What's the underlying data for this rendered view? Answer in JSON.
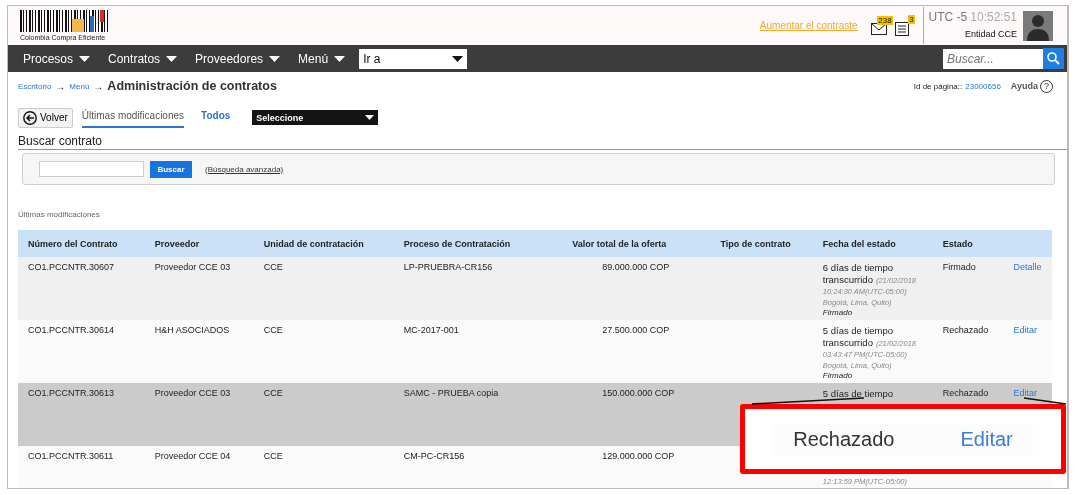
{
  "header": {
    "logo_text": "Colombia Compra Eficiente",
    "contrast_link": "Aumentar el contraste",
    "messages_count": "238",
    "notifications_count": "3",
    "timezone": "UTC -5",
    "time": "10:52:51",
    "user": "Entidad CCE"
  },
  "nav": {
    "items": [
      "Procesos",
      "Contratos",
      "Proveedores",
      "Menú"
    ],
    "goto": "Ir a",
    "search_placeholder": "Buscar..."
  },
  "breadcrumb": {
    "links": [
      "Escritorio",
      "Menú"
    ],
    "separator": "→",
    "help_mark": "?",
    "title": "Administración de contratos",
    "page_id_label": "Id de página::",
    "page_id": "23000656",
    "help": "Ayuda"
  },
  "toolbar": {
    "back": "Volver",
    "tabs": [
      {
        "label": "Últimas modificaciones",
        "selected": true
      },
      {
        "label": "Todos",
        "selected": false
      }
    ],
    "select": "Seleccione"
  },
  "search": {
    "title": "Buscar contrato",
    "button": "Buscar",
    "advanced": "(Búsqueda avanzada)"
  },
  "list_label": "Últimas modificaciones",
  "table": {
    "columns": [
      "Número del Contrato",
      "Proveedor",
      "Unidad de contratación",
      "Proceso de Contratación",
      "Valor total de la oferta",
      "Tipo de contrato",
      "Fecha del estado",
      "Estado"
    ],
    "rows": [
      {
        "number": "CO1.PCCNTR.30607",
        "provider": "Proveedor CCE 03",
        "unit": "CCE",
        "process": "LP-PRUEBRA-CR156",
        "value": "89.000.000 COP",
        "date": {
          "elapsed": "6 días de tiempo transcurrido",
          "stamp": "(21/02/2018 10:24:30 AM(UTC-05:00) Bogotá, Lima, Quito)",
          "state": "Firmado"
        },
        "status": "Firmado",
        "action": "Detalle",
        "selected": false
      },
      {
        "number": "CO1.PCCNTR.30614",
        "provider": "H&H ASOCIADOS",
        "unit": "CCE",
        "process": "MC-2017-001",
        "value": "27.500.000 COP",
        "date": {
          "elapsed": "5 días de tiempo transcurrido",
          "stamp": "(21/02/2018 03:43:47 PM(UTC-05:00) Bogotá, Lima, Quito)",
          "state": "Firmado"
        },
        "status": "Rechazado",
        "action": "Editar",
        "selected": false
      },
      {
        "number": "CO1.PCCNTR.30613",
        "provider": "Proveedor CCE 03",
        "unit": "CCE",
        "process": "SAMC - PRUEBA copia",
        "value": "150.000.000 COP",
        "date": {
          "elapsed": "5 días de tiempo"
        },
        "status": "Rechazado",
        "action": "Editar",
        "selected": true
      },
      {
        "number": "CO1.PCCNTR.30611",
        "provider": "Proveedor CCE 04",
        "unit": "CCE",
        "process": "CM-PC-CR156",
        "value": "129.000.000 COP",
        "date": {
          "stamp": "12:13:59 PM(UTC-05:00)"
        },
        "selected": false
      }
    ]
  },
  "callout": {
    "status": "Rechazado",
    "action": "Editar"
  }
}
